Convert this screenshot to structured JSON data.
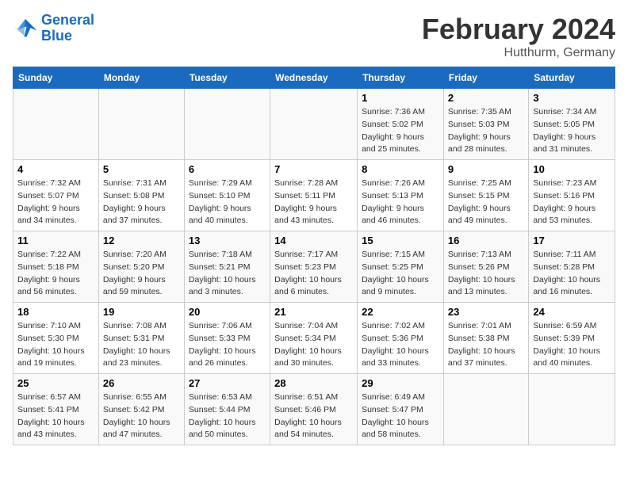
{
  "header": {
    "logo_general": "General",
    "logo_blue": "Blue",
    "month": "February 2024",
    "location": "Hutthurm, Germany"
  },
  "days_of_week": [
    "Sunday",
    "Monday",
    "Tuesday",
    "Wednesday",
    "Thursday",
    "Friday",
    "Saturday"
  ],
  "weeks": [
    {
      "days": [
        {
          "num": "",
          "info": ""
        },
        {
          "num": "",
          "info": ""
        },
        {
          "num": "",
          "info": ""
        },
        {
          "num": "",
          "info": ""
        },
        {
          "num": "1",
          "info": "Sunrise: 7:36 AM\nSunset: 5:02 PM\nDaylight: 9 hours\nand 25 minutes."
        },
        {
          "num": "2",
          "info": "Sunrise: 7:35 AM\nSunset: 5:03 PM\nDaylight: 9 hours\nand 28 minutes."
        },
        {
          "num": "3",
          "info": "Sunrise: 7:34 AM\nSunset: 5:05 PM\nDaylight: 9 hours\nand 31 minutes."
        }
      ]
    },
    {
      "days": [
        {
          "num": "4",
          "info": "Sunrise: 7:32 AM\nSunset: 5:07 PM\nDaylight: 9 hours\nand 34 minutes."
        },
        {
          "num": "5",
          "info": "Sunrise: 7:31 AM\nSunset: 5:08 PM\nDaylight: 9 hours\nand 37 minutes."
        },
        {
          "num": "6",
          "info": "Sunrise: 7:29 AM\nSunset: 5:10 PM\nDaylight: 9 hours\nand 40 minutes."
        },
        {
          "num": "7",
          "info": "Sunrise: 7:28 AM\nSunset: 5:11 PM\nDaylight: 9 hours\nand 43 minutes."
        },
        {
          "num": "8",
          "info": "Sunrise: 7:26 AM\nSunset: 5:13 PM\nDaylight: 9 hours\nand 46 minutes."
        },
        {
          "num": "9",
          "info": "Sunrise: 7:25 AM\nSunset: 5:15 PM\nDaylight: 9 hours\nand 49 minutes."
        },
        {
          "num": "10",
          "info": "Sunrise: 7:23 AM\nSunset: 5:16 PM\nDaylight: 9 hours\nand 53 minutes."
        }
      ]
    },
    {
      "days": [
        {
          "num": "11",
          "info": "Sunrise: 7:22 AM\nSunset: 5:18 PM\nDaylight: 9 hours\nand 56 minutes."
        },
        {
          "num": "12",
          "info": "Sunrise: 7:20 AM\nSunset: 5:20 PM\nDaylight: 9 hours\nand 59 minutes."
        },
        {
          "num": "13",
          "info": "Sunrise: 7:18 AM\nSunset: 5:21 PM\nDaylight: 10 hours\nand 3 minutes."
        },
        {
          "num": "14",
          "info": "Sunrise: 7:17 AM\nSunset: 5:23 PM\nDaylight: 10 hours\nand 6 minutes."
        },
        {
          "num": "15",
          "info": "Sunrise: 7:15 AM\nSunset: 5:25 PM\nDaylight: 10 hours\nand 9 minutes."
        },
        {
          "num": "16",
          "info": "Sunrise: 7:13 AM\nSunset: 5:26 PM\nDaylight: 10 hours\nand 13 minutes."
        },
        {
          "num": "17",
          "info": "Sunrise: 7:11 AM\nSunset: 5:28 PM\nDaylight: 10 hours\nand 16 minutes."
        }
      ]
    },
    {
      "days": [
        {
          "num": "18",
          "info": "Sunrise: 7:10 AM\nSunset: 5:30 PM\nDaylight: 10 hours\nand 19 minutes."
        },
        {
          "num": "19",
          "info": "Sunrise: 7:08 AM\nSunset: 5:31 PM\nDaylight: 10 hours\nand 23 minutes."
        },
        {
          "num": "20",
          "info": "Sunrise: 7:06 AM\nSunset: 5:33 PM\nDaylight: 10 hours\nand 26 minutes."
        },
        {
          "num": "21",
          "info": "Sunrise: 7:04 AM\nSunset: 5:34 PM\nDaylight: 10 hours\nand 30 minutes."
        },
        {
          "num": "22",
          "info": "Sunrise: 7:02 AM\nSunset: 5:36 PM\nDaylight: 10 hours\nand 33 minutes."
        },
        {
          "num": "23",
          "info": "Sunrise: 7:01 AM\nSunset: 5:38 PM\nDaylight: 10 hours\nand 37 minutes."
        },
        {
          "num": "24",
          "info": "Sunrise: 6:59 AM\nSunset: 5:39 PM\nDaylight: 10 hours\nand 40 minutes."
        }
      ]
    },
    {
      "days": [
        {
          "num": "25",
          "info": "Sunrise: 6:57 AM\nSunset: 5:41 PM\nDaylight: 10 hours\nand 43 minutes."
        },
        {
          "num": "26",
          "info": "Sunrise: 6:55 AM\nSunset: 5:42 PM\nDaylight: 10 hours\nand 47 minutes."
        },
        {
          "num": "27",
          "info": "Sunrise: 6:53 AM\nSunset: 5:44 PM\nDaylight: 10 hours\nand 50 minutes."
        },
        {
          "num": "28",
          "info": "Sunrise: 6:51 AM\nSunset: 5:46 PM\nDaylight: 10 hours\nand 54 minutes."
        },
        {
          "num": "29",
          "info": "Sunrise: 6:49 AM\nSunset: 5:47 PM\nDaylight: 10 hours\nand 58 minutes."
        },
        {
          "num": "",
          "info": ""
        },
        {
          "num": "",
          "info": ""
        }
      ]
    }
  ]
}
